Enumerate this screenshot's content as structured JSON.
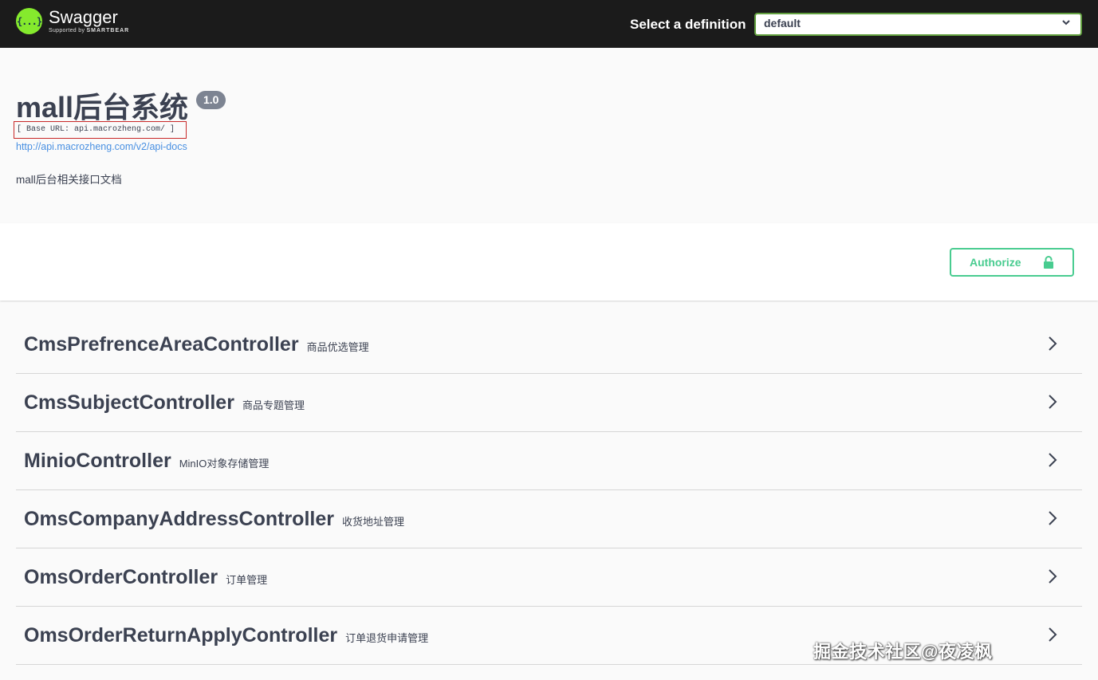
{
  "topbar": {
    "logo_title": "Swagger",
    "logo_sub_prefix": "Supported by",
    "logo_sub_brand": "SMARTBEAR",
    "logo_mark": "{...}",
    "definition_label": "Select a definition",
    "definition_value": "default"
  },
  "info": {
    "title": "mall后台系统",
    "version": "1.0",
    "base_url": "[ Base URL: api.macrozheng.com/ ]",
    "docs_link": "http://api.macrozheng.com/v2/api-docs",
    "description": "mall后台相关接口文档"
  },
  "auth": {
    "authorize_label": "Authorize",
    "icon": "lock-icon",
    "color": "#49cc90"
  },
  "controllers": [
    {
      "name": "CmsPrefrenceAreaController",
      "desc": "商品优选管理"
    },
    {
      "name": "CmsSubjectController",
      "desc": "商品专题管理"
    },
    {
      "name": "MinioController",
      "desc": "MinIO对象存储管理"
    },
    {
      "name": "OmsCompanyAddressController",
      "desc": "收货地址管理"
    },
    {
      "name": "OmsOrderController",
      "desc": "订单管理"
    },
    {
      "name": "OmsOrderReturnApplyController",
      "desc": "订单退货申请管理"
    }
  ],
  "watermark": "掘金技术社区@夜凌枫",
  "colors": {
    "topbar": "#1b1b1b",
    "accent_green": "#85ea2d",
    "select_border": "#62a03f",
    "link": "#4990e2",
    "base_url_border": "#c82828"
  }
}
